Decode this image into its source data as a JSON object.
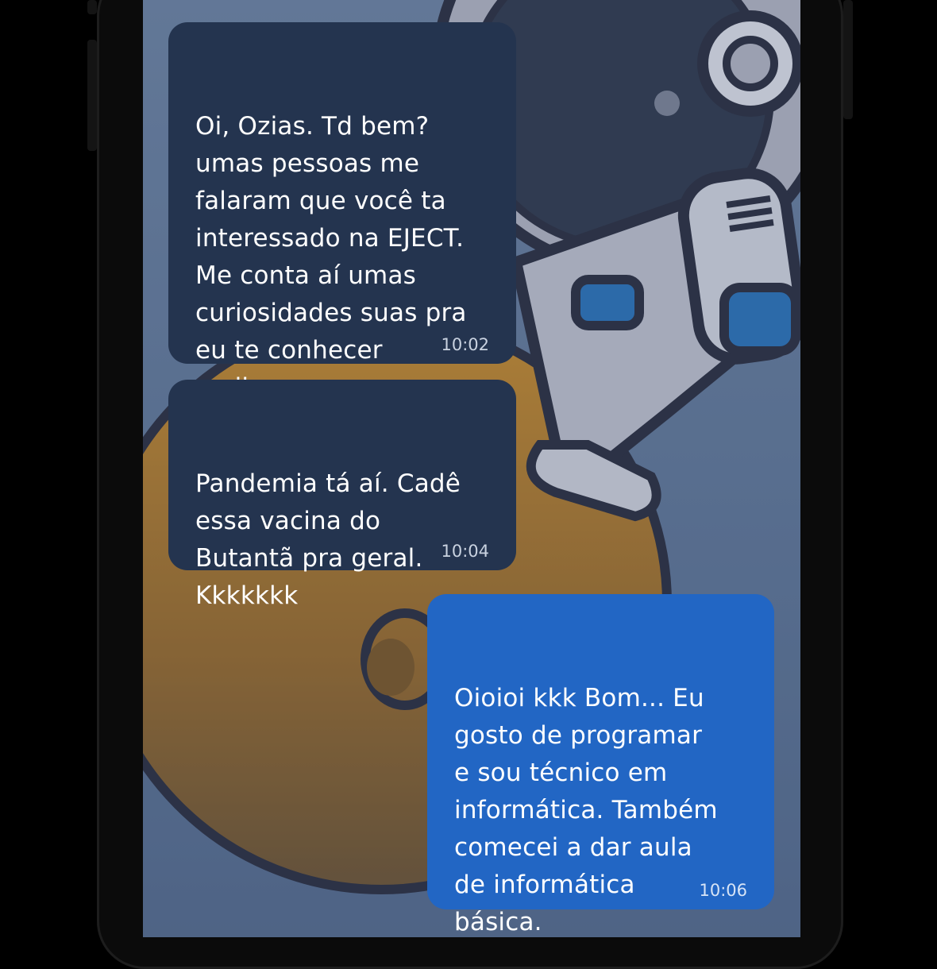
{
  "chat": {
    "messages": [
      {
        "direction": "incoming",
        "text": "Oi, Ozias. Td bem?\numas pessoas me\nfalaram que você ta\ninteressado na EJECT.\nMe conta aí umas\ncuriosidades suas pra\neu te conhecer\nmelhor.",
        "time": "10:02"
      },
      {
        "direction": "incoming",
        "text": "Pandemia tá aí. Cadê\nessa vacina do\nButantã pra geral.\nKkkkkkk",
        "time": "10:04"
      },
      {
        "direction": "outgoing",
        "text": "Oioioi kkk Bom... Eu\ngosto de programar\ne sou técnico em\ninformática. Também\ncomecei a dar aula\nde informática\nbásica.",
        "time": "10:06"
      }
    ]
  },
  "colors": {
    "incoming_bubble": "#24344f",
    "outgoing_bubble": "#2266c4",
    "wallpaper": "#5f7596"
  },
  "wallpaper": {
    "icon": "astronaut-on-planet-illustration"
  }
}
